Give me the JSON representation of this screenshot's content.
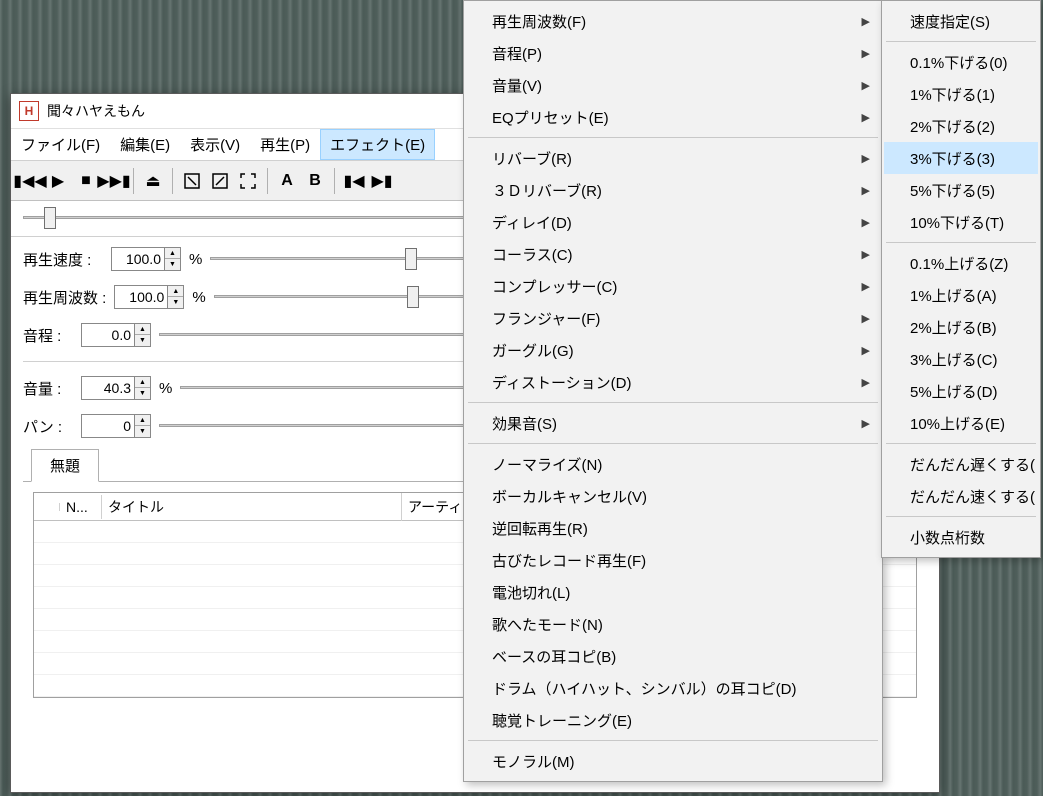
{
  "window": {
    "icon_letter": "H",
    "title": "聞々ハヤえもん"
  },
  "menubar": {
    "file": "ファイル(F)",
    "edit": "編集(E)",
    "view": "表示(V)",
    "play": "再生(P)",
    "effect": "エフェクト(E)"
  },
  "controls": {
    "speed": {
      "label": "再生速度 :",
      "value": "100.0",
      "unit": "%"
    },
    "freq": {
      "label": "再生周波数 :",
      "value": "100.0",
      "unit": "%"
    },
    "pitch": {
      "label": "音程 :",
      "value": "0.0"
    },
    "volume": {
      "label": "音量 :",
      "value": "40.3",
      "unit": "%"
    },
    "pan": {
      "label": "パン :",
      "value": "0"
    }
  },
  "tabs": {
    "untitled": "無題"
  },
  "table": {
    "cols": {
      "n": "N...",
      "title": "タイトル",
      "artist": "アーティ"
    }
  },
  "effect_menu": {
    "items": [
      {
        "label": "再生周波数(F)",
        "sub": true
      },
      {
        "label": "音程(P)",
        "sub": true
      },
      {
        "label": "音量(V)",
        "sub": true
      },
      {
        "label": "EQプリセット(E)",
        "sub": true
      },
      {
        "sep": true
      },
      {
        "label": "リバーブ(R)",
        "sub": true
      },
      {
        "label": "３Ｄリバーブ(R)",
        "sub": true
      },
      {
        "label": "ディレイ(D)",
        "sub": true
      },
      {
        "label": "コーラス(C)",
        "sub": true
      },
      {
        "label": "コンプレッサー(C)",
        "sub": true
      },
      {
        "label": "フランジャー(F)",
        "sub": true
      },
      {
        "label": "ガーグル(G)",
        "sub": true
      },
      {
        "label": "ディストーション(D)",
        "sub": true
      },
      {
        "sep": true
      },
      {
        "label": "効果音(S)",
        "sub": true
      },
      {
        "sep": true
      },
      {
        "label": "ノーマライズ(N)"
      },
      {
        "label": "ボーカルキャンセル(V)"
      },
      {
        "label": "逆回転再生(R)"
      },
      {
        "label": "古びたレコード再生(F)"
      },
      {
        "label": "電池切れ(L)"
      },
      {
        "label": "歌へたモード(N)"
      },
      {
        "label": "ベースの耳コピ(B)"
      },
      {
        "label": "ドラム（ハイハット、シンバル）の耳コピ(D)"
      },
      {
        "label": "聴覚トレーニング(E)"
      },
      {
        "sep": true
      },
      {
        "label": "モノラル(M)"
      }
    ]
  },
  "submenu": {
    "items": [
      {
        "label": "速度指定(S)"
      },
      {
        "sep": true
      },
      {
        "label": "0.1%下げる(0)"
      },
      {
        "label": "1%下げる(1)"
      },
      {
        "label": "2%下げる(2)"
      },
      {
        "label": "3%下げる(3)",
        "hover": true
      },
      {
        "label": "5%下げる(5)"
      },
      {
        "label": "10%下げる(T)"
      },
      {
        "sep": true
      },
      {
        "label": "0.1%上げる(Z)"
      },
      {
        "label": "1%上げる(A)"
      },
      {
        "label": "2%上げる(B)"
      },
      {
        "label": "3%上げる(C)"
      },
      {
        "label": "5%上げる(D)"
      },
      {
        "label": "10%上げる(E)"
      },
      {
        "sep": true
      },
      {
        "label": "だんだん遅くする("
      },
      {
        "label": "だんだん速くする("
      },
      {
        "sep": true
      },
      {
        "label": "小数点桁数"
      }
    ]
  }
}
